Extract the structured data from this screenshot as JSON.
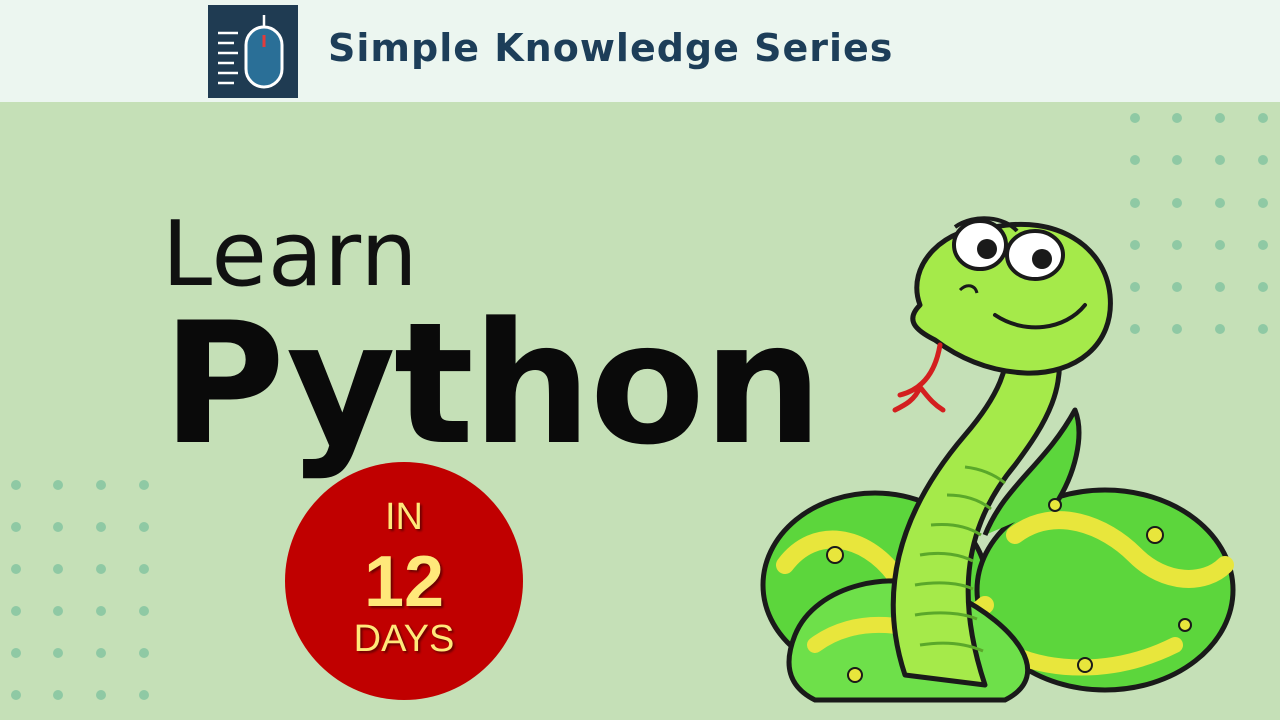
{
  "header": {
    "series_title": "Simple Knowledge Series",
    "logo_icon": "mouse-document-icon"
  },
  "hero": {
    "line1": "Learn",
    "line2": "Python"
  },
  "badge": {
    "prefix": "IN",
    "number": "12",
    "suffix": "DAYS"
  },
  "illustration": {
    "icon": "cartoon-snake-icon"
  },
  "colors": {
    "background": "#c5e0b7",
    "header_background": "#ecf6f0",
    "header_text": "#1d3e59",
    "logo_background": "#1f3b52",
    "badge_red": "#c00000",
    "badge_text": "#ffe87a",
    "dot_color": "#8fc9a4"
  }
}
